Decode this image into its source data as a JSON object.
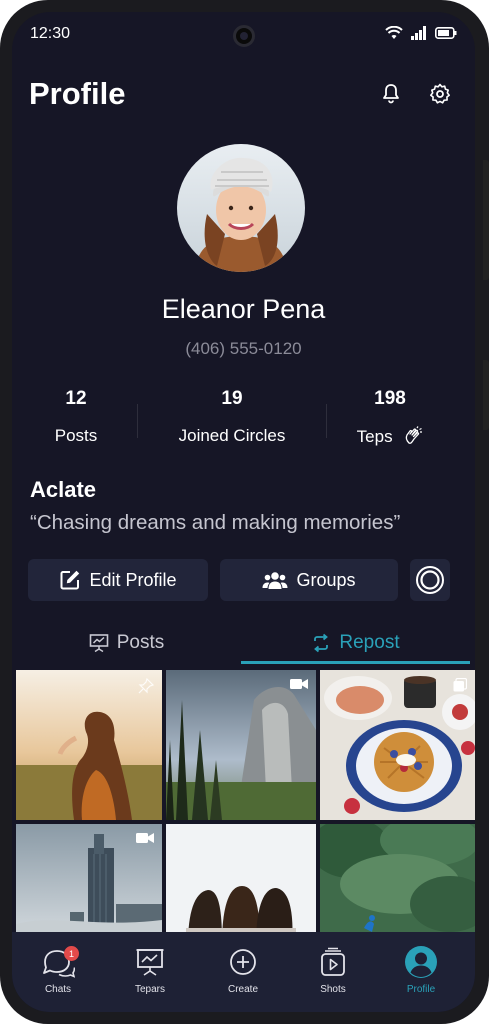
{
  "status_bar": {
    "time": "12:30"
  },
  "header": {
    "title": "Profile",
    "icons": [
      "bell-icon",
      "gear-icon"
    ]
  },
  "profile": {
    "name": "Eleanor Pena",
    "phone": "(406) 555-0120"
  },
  "stats": [
    {
      "value": "12",
      "label": "Posts"
    },
    {
      "value": "19",
      "label": "Joined Circles"
    },
    {
      "value": "198",
      "label": "Teps"
    }
  ],
  "bio": {
    "title": "Aclate",
    "text": "“Chasing dreams and making memories”"
  },
  "actions": {
    "edit_profile": "Edit Profile",
    "groups": "Groups"
  },
  "tabs": [
    {
      "label": "Posts",
      "active": false
    },
    {
      "label": "Repost",
      "active": true
    }
  ],
  "grid_items": [
    {
      "subject": "woman in field at sunset",
      "badge": "pin-icon"
    },
    {
      "subject": "mountain valley with pines",
      "badge": "video-icon"
    },
    {
      "subject": "waffle breakfast with coffee",
      "badge": "multi-photo-icon"
    },
    {
      "subject": "foggy city skyline",
      "badge": "video-icon"
    },
    {
      "subject": "three friends from behind",
      "badge": ""
    },
    {
      "subject": "peacock in forest",
      "badge": ""
    }
  ],
  "nav": [
    {
      "label": "Chats",
      "badge": "1",
      "icon": "chat-icon"
    },
    {
      "label": "Tepars",
      "icon": "presentation-icon"
    },
    {
      "label": "Create",
      "icon": "plus-circle-icon"
    },
    {
      "label": "Shots",
      "icon": "shots-icon"
    },
    {
      "label": "Profile",
      "icon": "profile-icon",
      "active": true
    }
  ],
  "colors": {
    "background": "#161626",
    "accent": "#2aa1b8",
    "surface": "#22253a",
    "navbar": "#1e2135"
  }
}
